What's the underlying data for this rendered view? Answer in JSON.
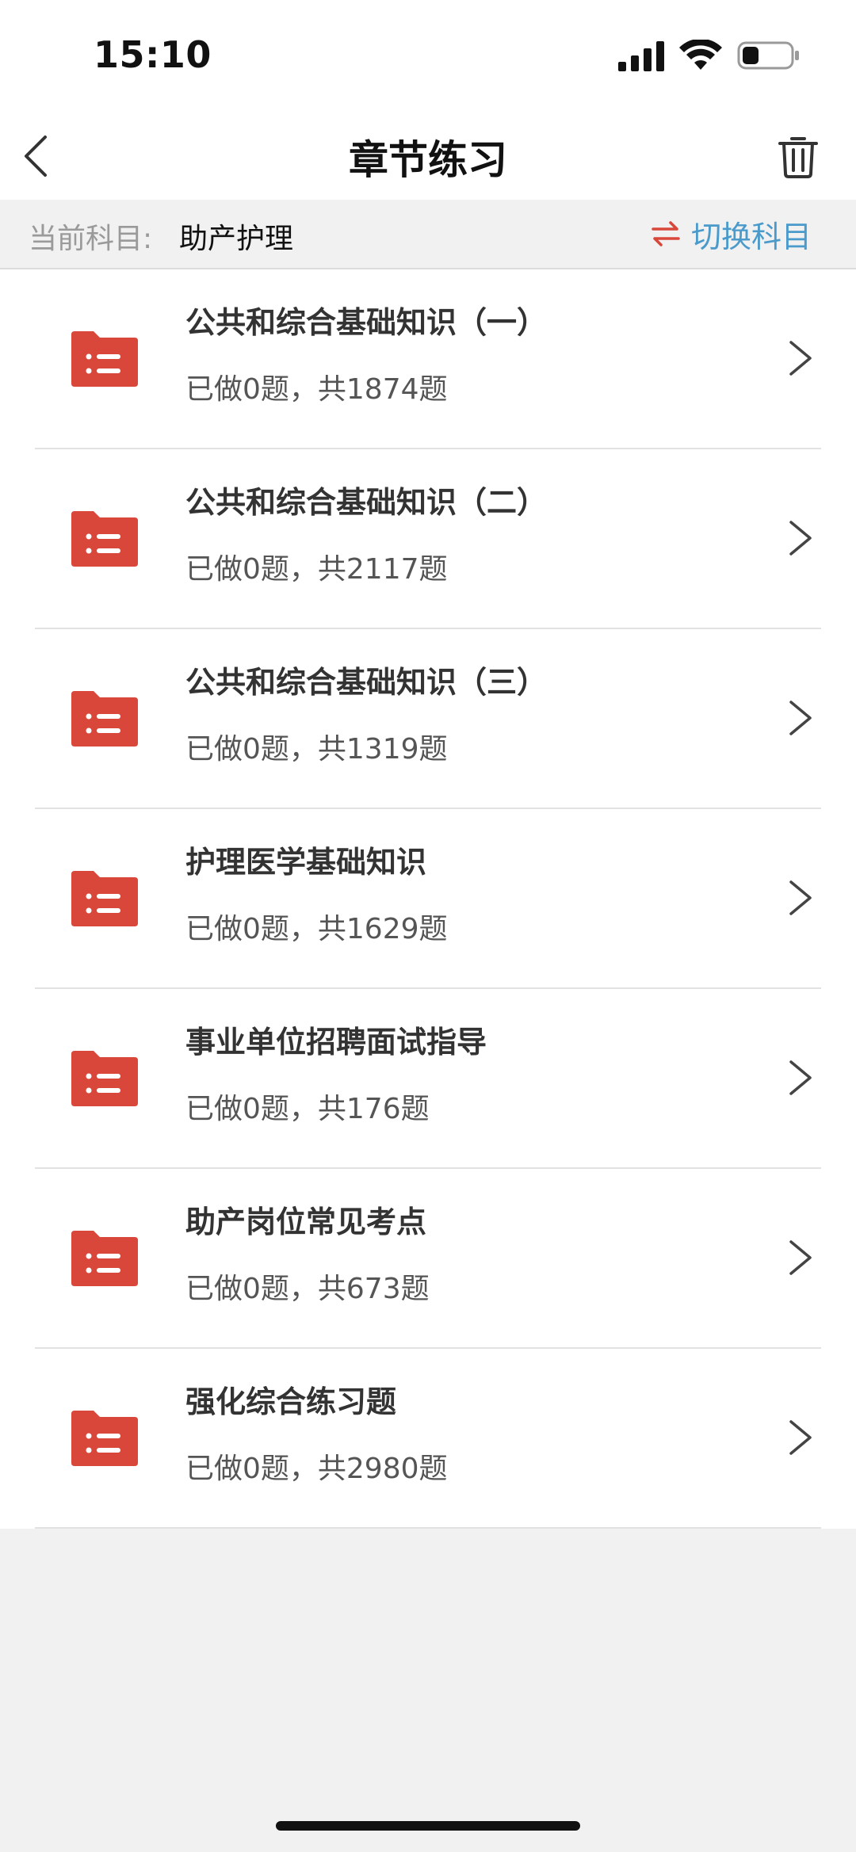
{
  "status_bar": {
    "time": "15:10"
  },
  "nav": {
    "title": "章节练习"
  },
  "subject_bar": {
    "label": "当前科目:",
    "value": "助产护理",
    "switch_label": "切换科目"
  },
  "colors": {
    "accent_red": "#d9473a",
    "link_blue": "#4a9acb"
  },
  "chapters": [
    {
      "title": "公共和综合基础知识（一）",
      "count": "已做0题，共1874题"
    },
    {
      "title": "公共和综合基础知识（二）",
      "count": "已做0题，共2117题"
    },
    {
      "title": "公共和综合基础知识（三）",
      "count": "已做0题，共1319题"
    },
    {
      "title": "护理医学基础知识",
      "count": "已做0题，共1629题"
    },
    {
      "title": "事业单位招聘面试指导",
      "count": "已做0题，共176题"
    },
    {
      "title": "助产岗位常见考点",
      "count": "已做0题，共673题"
    },
    {
      "title": "强化综合练习题",
      "count": "已做0题，共2980题"
    }
  ]
}
